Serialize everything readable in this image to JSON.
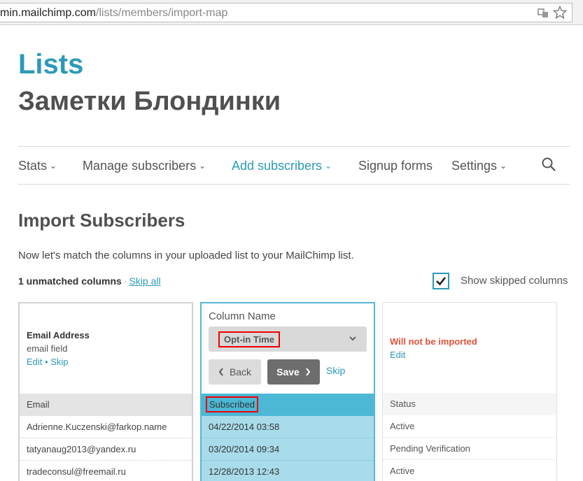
{
  "browser": {
    "url_host": "min.mailchimp.com",
    "url_path": "/lists/members/import-map"
  },
  "page": {
    "section": "Lists",
    "list_name": "Заметки Блондинки"
  },
  "nav": {
    "items": [
      {
        "label": "Stats"
      },
      {
        "label": "Manage subscribers"
      },
      {
        "label": "Add subscribers"
      },
      {
        "label": "Signup forms"
      },
      {
        "label": "Settings"
      }
    ]
  },
  "import": {
    "title": "Import Subscribers",
    "intro": "Now let's match the columns in your uploaded list to your MailChimp list.",
    "unmatched_text": "1 unmatched columns",
    "skip_all": "Skip all",
    "show_skipped_label": "Show skipped columns",
    "show_skipped_checked": true
  },
  "columns": {
    "matched": {
      "title": "Email Address",
      "subtitle": "email field",
      "edit": "Edit",
      "skip": "Skip",
      "header": "Email",
      "rows": [
        "Adrienne.Kuczenski@farkop.name",
        "tatyanaug2013@yandex.ru",
        "tradeconsul@freemail.ru"
      ]
    },
    "editing": {
      "label": "Column Name",
      "selected": "Opt-in Time",
      "back": "Back",
      "save": "Save",
      "skip": "Skip",
      "header": "Subscribed",
      "rows": [
        "04/22/2014 03:58",
        "03/20/2014 09:34",
        "12/28/2013 12:43"
      ]
    },
    "skipped": {
      "warning": "Will not be imported",
      "edit": "Edit",
      "header": "Status",
      "rows": [
        "Active",
        "Pending Verification",
        "Active"
      ]
    }
  }
}
